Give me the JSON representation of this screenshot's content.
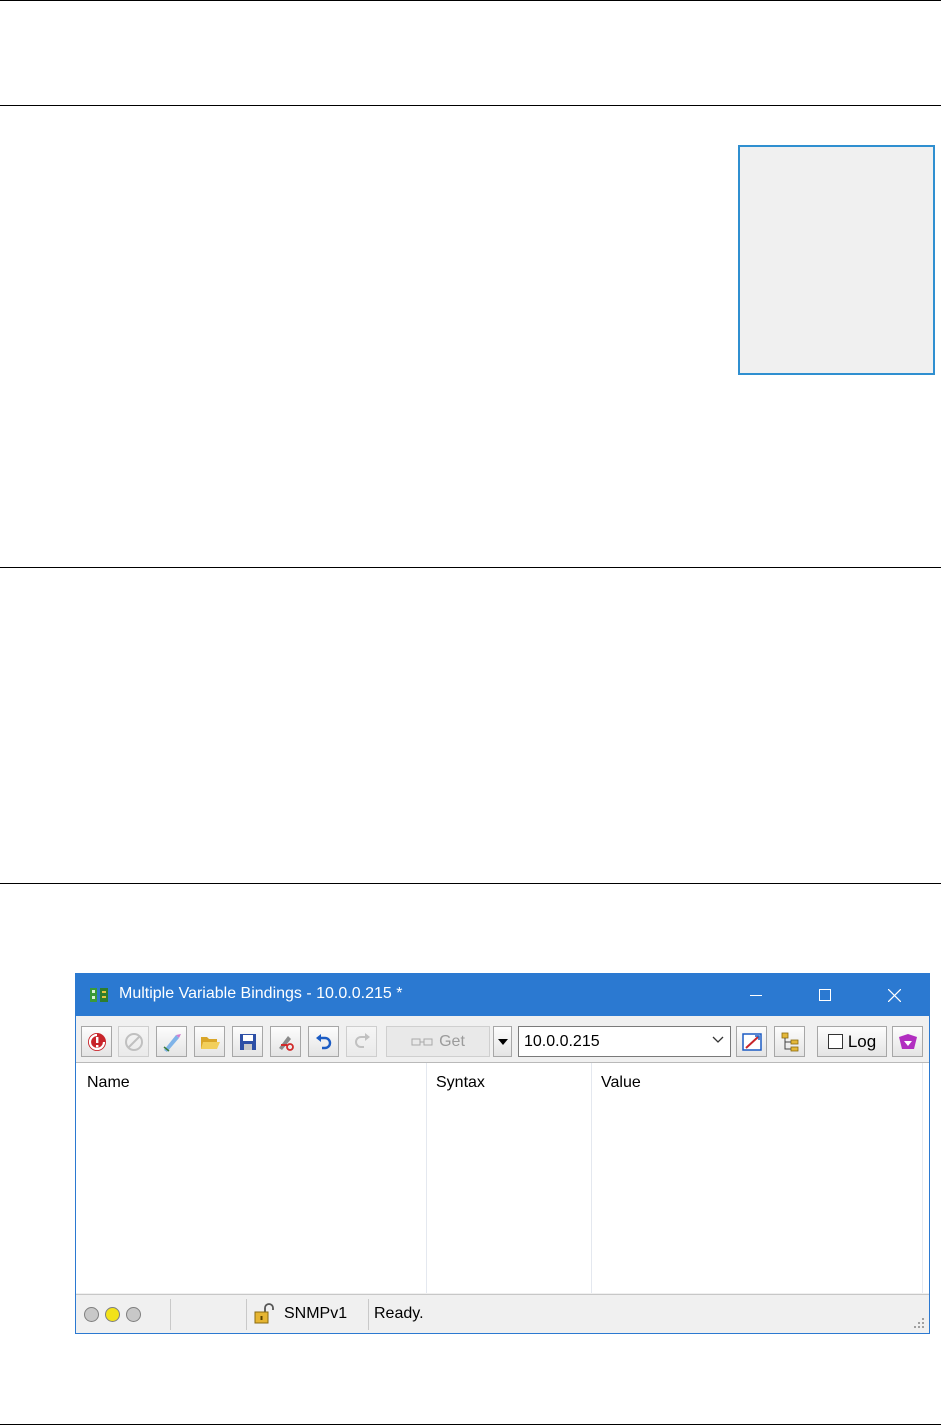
{
  "window": {
    "title": "Multiple Variable Bindings - 10.0.0.215 *",
    "controls": {
      "minimize": "minimize",
      "maximize": "maximize",
      "close": "close"
    }
  },
  "toolbar": {
    "buttons": [
      {
        "name": "stop-icon",
        "state": "enabled"
      },
      {
        "name": "cancel-icon",
        "state": "disabled"
      },
      {
        "name": "edit-icon",
        "state": "enabled"
      },
      {
        "name": "open-folder-icon",
        "state": "enabled"
      },
      {
        "name": "save-icon",
        "state": "enabled"
      },
      {
        "name": "delete-binding-icon",
        "state": "enabled"
      },
      {
        "name": "undo-icon",
        "state": "enabled"
      },
      {
        "name": "redo-icon",
        "state": "disabled"
      }
    ],
    "get_label": "Get",
    "host_value": "10.0.0.215",
    "log_label": "Log",
    "log_checked": false
  },
  "table": {
    "columns": [
      "Name",
      "Syntax",
      "Value"
    ],
    "rows": []
  },
  "statusbar": {
    "leds": [
      "gray",
      "yellow",
      "gray"
    ],
    "protocol": "SNMPv1",
    "status": "Ready."
  },
  "colors": {
    "titlebar": "#2b79d1",
    "accent_box_border": "#2f8fd0",
    "led_yellow": "#f2e21a",
    "led_gray": "#c8c8c8"
  }
}
